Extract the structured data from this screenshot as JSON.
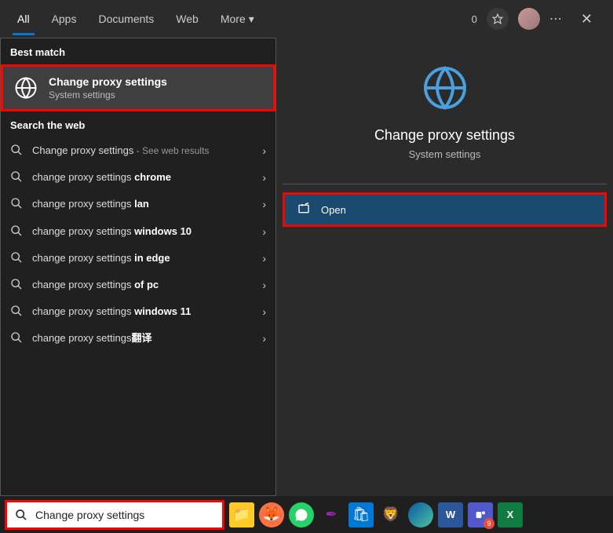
{
  "tabs": {
    "all": "All",
    "apps": "Apps",
    "documents": "Documents",
    "web": "Web",
    "more": "More"
  },
  "top_right": {
    "count": "0"
  },
  "sections": {
    "best_match": "Best match",
    "search_web": "Search the web"
  },
  "best_match": {
    "title": "Change proxy settings",
    "subtitle": "System settings"
  },
  "web_results": [
    {
      "prefix": "Change proxy settings",
      "bold": "",
      "suffix": " - See web results"
    },
    {
      "prefix": "change proxy settings ",
      "bold": "chrome",
      "suffix": ""
    },
    {
      "prefix": "change proxy settings ",
      "bold": "lan",
      "suffix": ""
    },
    {
      "prefix": "change proxy settings ",
      "bold": "windows 10",
      "suffix": ""
    },
    {
      "prefix": "change proxy settings ",
      "bold": "in edge",
      "suffix": ""
    },
    {
      "prefix": "change proxy settings ",
      "bold": "of pc",
      "suffix": ""
    },
    {
      "prefix": "change proxy settings ",
      "bold": "windows 11",
      "suffix": ""
    },
    {
      "prefix": "change proxy settings",
      "bold": "翻译",
      "suffix": ""
    }
  ],
  "detail": {
    "title": "Change proxy settings",
    "subtitle": "System settings",
    "open": "Open"
  },
  "search_box": {
    "value": "Change proxy settings"
  },
  "taskbar": {
    "teams_badge": "9"
  }
}
